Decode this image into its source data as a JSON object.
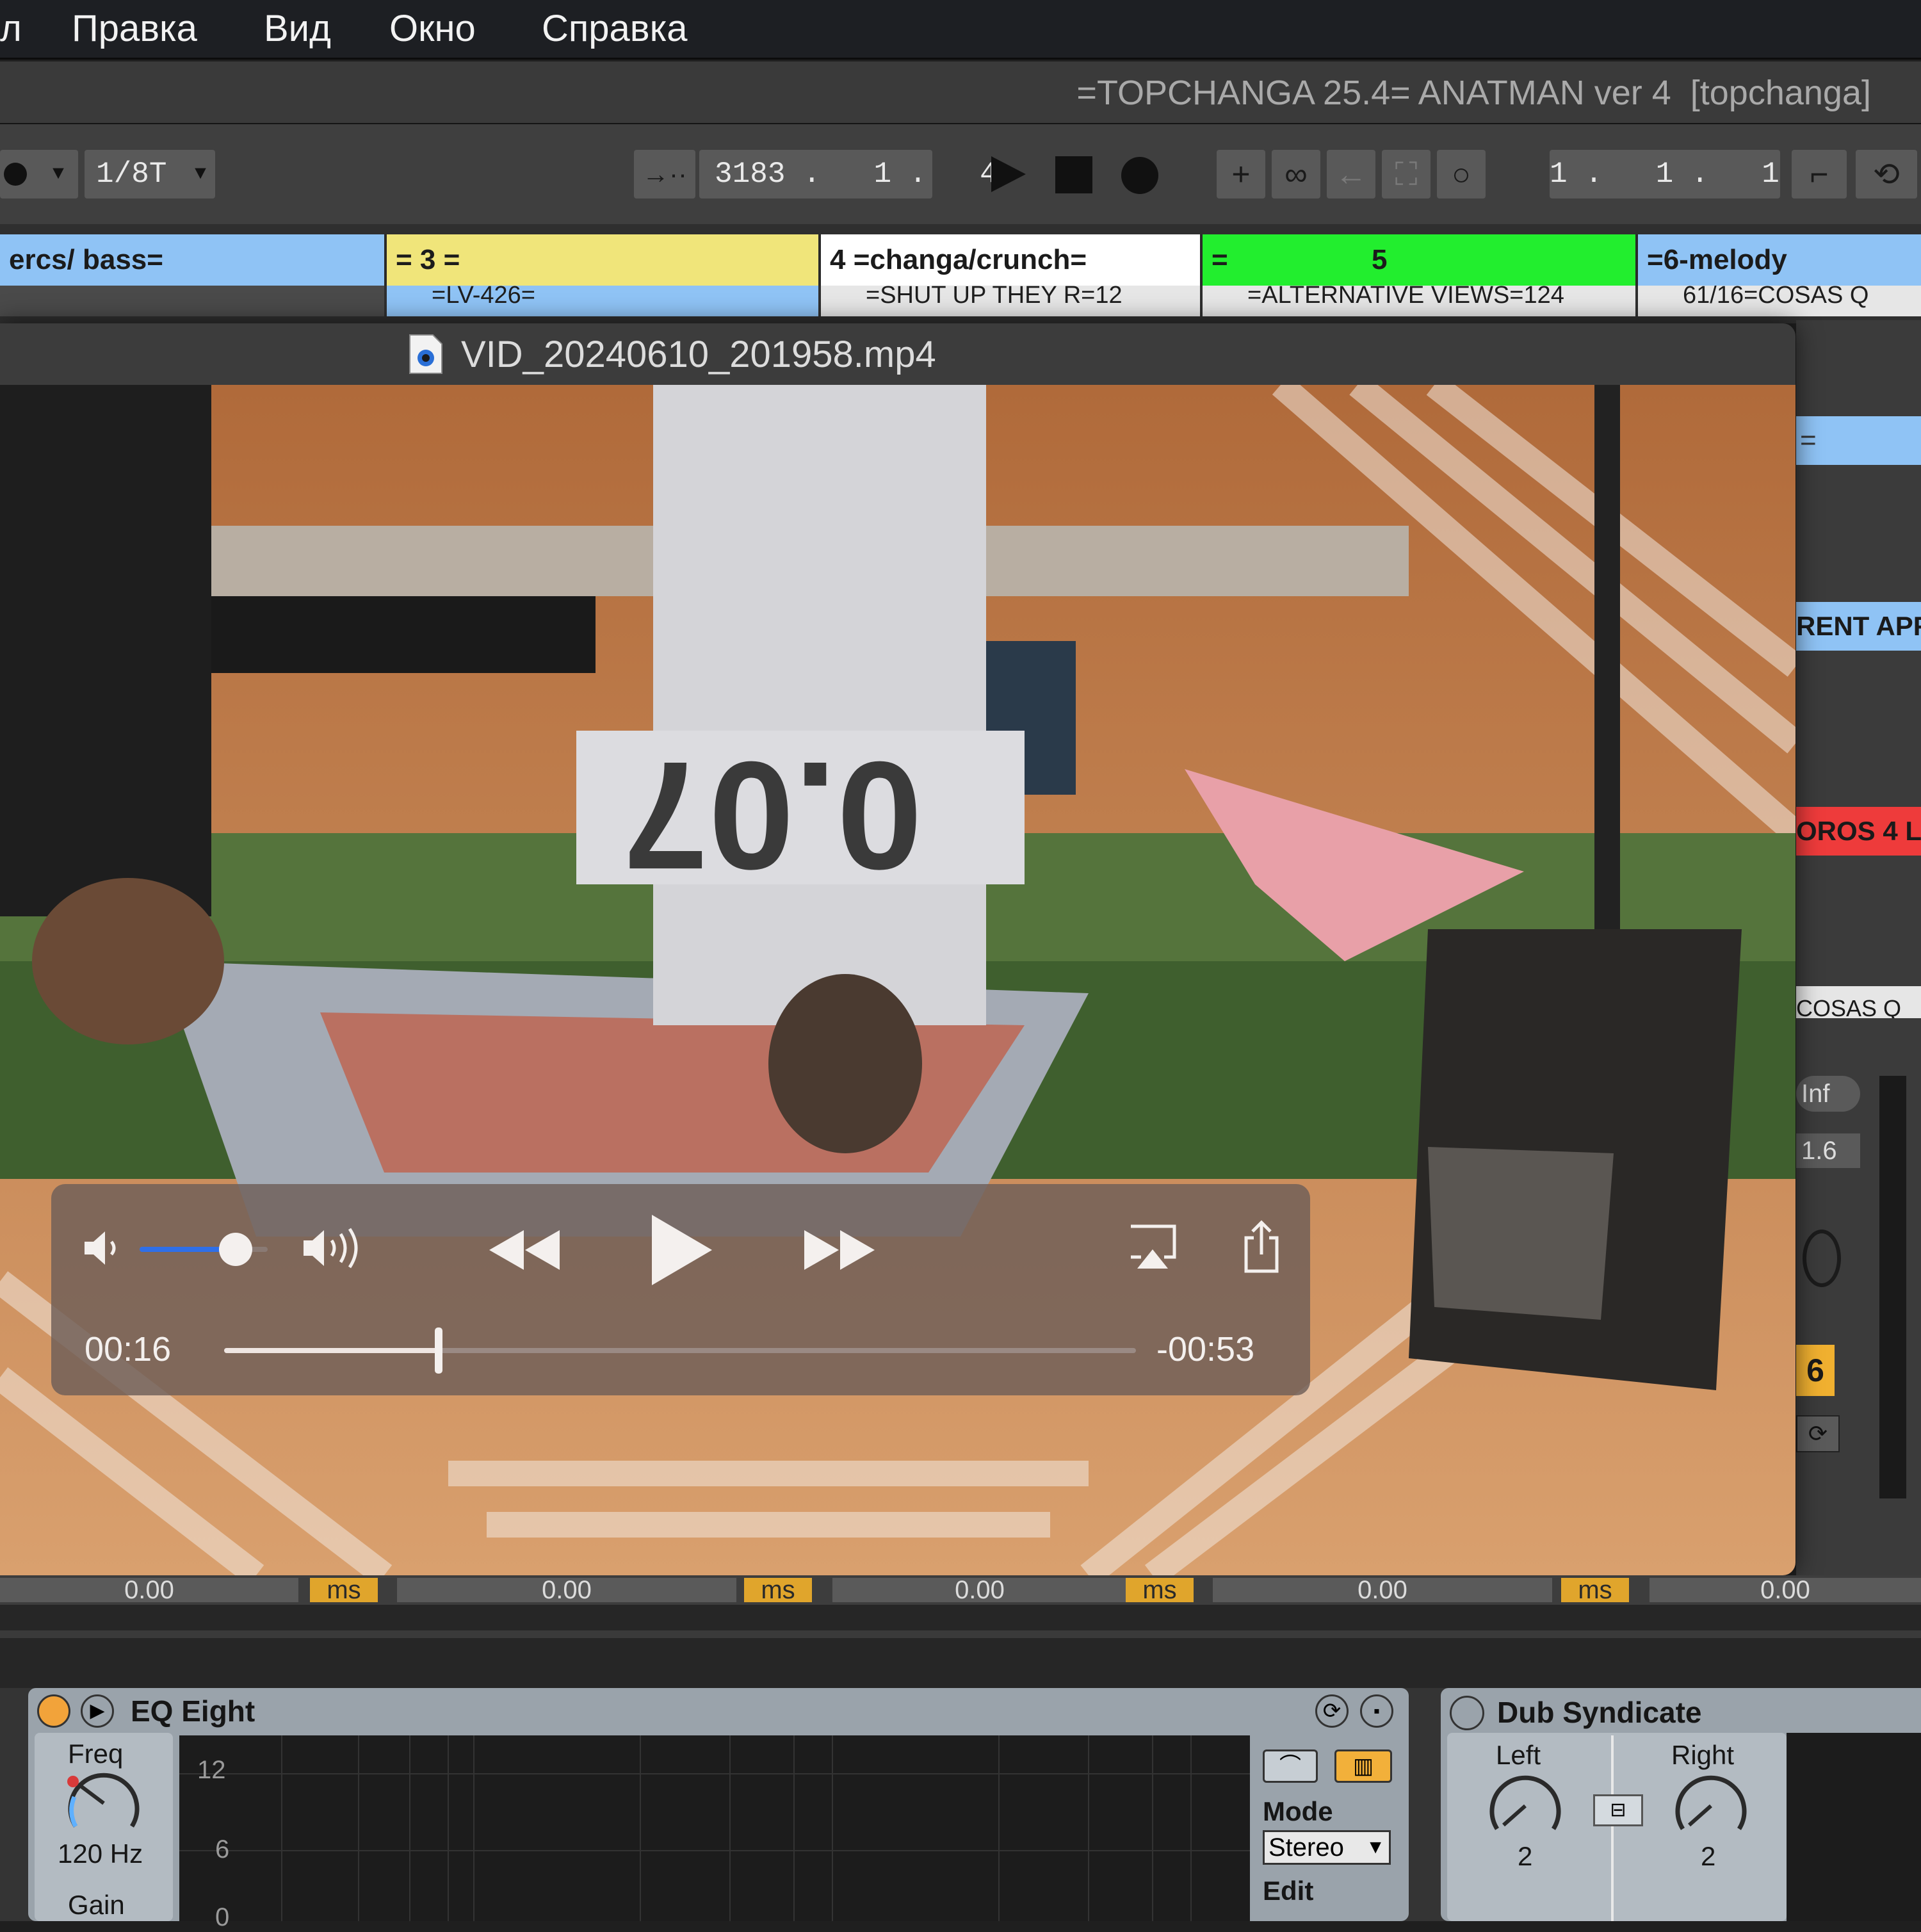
{
  "menubar": {
    "items": [
      "л",
      "Правка",
      "Вид",
      "Окно",
      "Справка"
    ]
  },
  "app": {
    "title": "=TOPCHANGA 25.4= ANATMAN ver 4  [topchanga]"
  },
  "transport": {
    "quantize": "1/8T",
    "position": "3183 .   1 .   4",
    "loop_start": "1 .   1 .   1"
  },
  "tracks": [
    {
      "name": "ercs/ bass=",
      "clip": "",
      "color": "#8fc3f5"
    },
    {
      "name": "= 3 =",
      "clip": "=LV-426=",
      "color": "#f0e57a"
    },
    {
      "name": "4 =changa/crunch=",
      "clip": "=SHUT UP THEY R=12",
      "color": "#ffffff"
    },
    {
      "name": "=",
      "name2": "5",
      "clip": "=ALTERNATIVE VIEWS=124",
      "color": "#22ee2e"
    },
    {
      "name": "=6-melody",
      "clip": "61/16=COSAS Q",
      "color": "#8fc3f5"
    }
  ],
  "right_peek": {
    "labels": [
      "=",
      "RENT APF",
      "OROS 4 LI",
      "COSAS Q"
    ],
    "inf": "Inf",
    "value": "1.6",
    "orange_num": "6"
  },
  "video": {
    "filename": "VID_20240610_201958.mp4",
    "elapsed": "00:16",
    "remaining": "-00:53",
    "progress": 0.235,
    "volume": 0.75
  },
  "mixer": {
    "values": [
      "0.00",
      "0.00",
      "0.00",
      "0.00",
      "0.00"
    ],
    "unit": "ms"
  },
  "eq_eight": {
    "title": "EQ Eight",
    "freq_label": "Freq",
    "freq_value": "120 Hz",
    "gain_label": "Gain",
    "scale": [
      "12",
      "6",
      "0"
    ],
    "mode_label": "Mode",
    "mode_value": "Stereo",
    "edit_label": "Edit"
  },
  "dub_syndicate": {
    "title": "Dub Syndicate",
    "left_label": "Left",
    "left_value": "2",
    "right_label": "Right",
    "right_value": "2"
  }
}
